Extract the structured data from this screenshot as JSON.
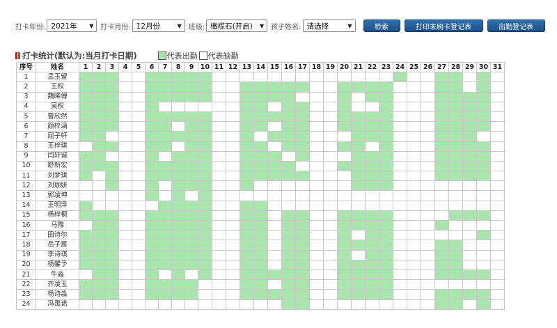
{
  "filters": {
    "year_label": "打卡年份:",
    "year_value": "2021年",
    "month_label": "打卡月份:",
    "month_value": "12月份",
    "class_label": "班级:",
    "class_value": "橄榄石(开启)",
    "child_label": "孩子姓名:",
    "child_value": "请选择"
  },
  "buttons": {
    "search": "检索",
    "print_unpunched": "打印未刷卡登记表",
    "attendance_register": "出勤登记表"
  },
  "stats": {
    "title": "打卡统计(默认为:当月打卡日期)",
    "legend_present": "代表出勤",
    "legend_absent": "代表缺勤"
  },
  "colors": {
    "present": "#a8e6ad",
    "absent": "#ffffff",
    "button": "#1f5a96"
  },
  "table": {
    "col_index": "序号",
    "col_name": "姓名",
    "days": [
      "1",
      "2",
      "3",
      "4",
      "5",
      "6",
      "7",
      "8",
      "9",
      "10",
      "11",
      "12",
      "13",
      "14",
      "15",
      "16",
      "17",
      "18",
      "19",
      "20",
      "21",
      "22",
      "23",
      "24",
      "25",
      "26",
      "27",
      "28",
      "29",
      "30",
      "31"
    ],
    "rows": [
      {
        "index": "1",
        "name": "孟玉留",
        "attendance": [
          1,
          1,
          1,
          0,
          0,
          1,
          1,
          1,
          1,
          1,
          0,
          0,
          0,
          0,
          0,
          0,
          0,
          0,
          0,
          0,
          0,
          0,
          0,
          1,
          0,
          0,
          1,
          1,
          0,
          1,
          0
        ]
      },
      {
        "index": "2",
        "name": "王权",
        "attendance": [
          1,
          1,
          1,
          0,
          0,
          1,
          1,
          1,
          1,
          1,
          0,
          0,
          1,
          1,
          1,
          1,
          1,
          0,
          0,
          1,
          1,
          1,
          1,
          0,
          0,
          0,
          1,
          1,
          0,
          1,
          0
        ]
      },
      {
        "index": "3",
        "name": "魏晞傅",
        "attendance": [
          1,
          1,
          1,
          0,
          0,
          1,
          1,
          1,
          1,
          1,
          0,
          0,
          1,
          1,
          1,
          1,
          0,
          0,
          0,
          1,
          0,
          1,
          1,
          0,
          0,
          0,
          1,
          1,
          1,
          1,
          0
        ]
      },
      {
        "index": "4",
        "name": "吴权",
        "attendance": [
          1,
          1,
          1,
          0,
          0,
          1,
          0,
          0,
          0,
          0,
          0,
          0,
          1,
          1,
          0,
          1,
          1,
          0,
          0,
          1,
          0,
          0,
          1,
          0,
          0,
          0,
          1,
          1,
          1,
          1,
          0
        ]
      },
      {
        "index": "5",
        "name": "曹欣然",
        "attendance": [
          1,
          1,
          1,
          0,
          0,
          1,
          1,
          1,
          1,
          1,
          0,
          0,
          1,
          1,
          1,
          1,
          1,
          0,
          0,
          1,
          1,
          1,
          1,
          0,
          0,
          0,
          1,
          1,
          1,
          1,
          0
        ]
      },
      {
        "index": "6",
        "name": "颜梓涵",
        "attendance": [
          1,
          1,
          1,
          0,
          0,
          1,
          1,
          0,
          1,
          1,
          0,
          0,
          1,
          1,
          0,
          1,
          1,
          0,
          0,
          1,
          1,
          1,
          1,
          0,
          0,
          0,
          1,
          1,
          1,
          1,
          0
        ]
      },
      {
        "index": "7",
        "name": "屈子轩",
        "attendance": [
          1,
          1,
          0,
          0,
          0,
          1,
          1,
          1,
          1,
          1,
          0,
          0,
          1,
          0,
          1,
          1,
          1,
          0,
          0,
          0,
          1,
          1,
          1,
          0,
          0,
          0,
          1,
          1,
          1,
          0,
          0
        ]
      },
      {
        "index": "8",
        "name": "王梓琪",
        "attendance": [
          0,
          1,
          1,
          0,
          0,
          1,
          1,
          0,
          1,
          1,
          0,
          0,
          1,
          1,
          0,
          1,
          1,
          0,
          0,
          1,
          1,
          0,
          1,
          0,
          0,
          0,
          1,
          1,
          1,
          1,
          0
        ]
      },
      {
        "index": "9",
        "name": "闫轩诚",
        "attendance": [
          1,
          1,
          0,
          0,
          0,
          1,
          0,
          1,
          1,
          1,
          0,
          0,
          1,
          1,
          1,
          0,
          1,
          0,
          0,
          0,
          1,
          1,
          1,
          0,
          0,
          0,
          1,
          1,
          1,
          1,
          0
        ]
      },
      {
        "index": "10",
        "name": "舒新宏",
        "attendance": [
          1,
          1,
          1,
          0,
          0,
          1,
          1,
          1,
          1,
          1,
          0,
          0,
          1,
          1,
          1,
          1,
          0,
          0,
          0,
          1,
          1,
          1,
          1,
          0,
          0,
          0,
          1,
          1,
          1,
          1,
          0
        ]
      },
      {
        "index": "11",
        "name": "刘梦琪",
        "attendance": [
          1,
          0,
          1,
          0,
          0,
          1,
          1,
          1,
          1,
          1,
          0,
          0,
          1,
          1,
          1,
          1,
          1,
          0,
          0,
          0,
          1,
          1,
          1,
          0,
          0,
          0,
          1,
          1,
          1,
          1,
          0
        ]
      },
      {
        "index": "12",
        "name": "刘珈妍",
        "attendance": [
          0,
          0,
          1,
          0,
          0,
          1,
          0,
          1,
          1,
          1,
          0,
          0,
          1,
          0,
          0,
          0,
          0,
          0,
          0,
          0,
          1,
          1,
          1,
          0,
          0,
          0,
          0,
          0,
          0,
          0,
          0
        ]
      },
      {
        "index": "13",
        "name": "郭凌坤",
        "attendance": [
          0,
          0,
          0,
          0,
          0,
          1,
          0,
          1,
          0,
          1,
          0,
          0,
          0,
          0,
          0,
          0,
          0,
          0,
          0,
          0,
          0,
          0,
          0,
          0,
          0,
          0,
          0,
          0,
          0,
          0,
          0
        ]
      },
      {
        "index": "14",
        "name": "王明泽",
        "attendance": [
          1,
          0,
          0,
          0,
          0,
          0,
          1,
          1,
          1,
          1,
          0,
          0,
          1,
          1,
          0,
          0,
          0,
          0,
          0,
          0,
          0,
          0,
          0,
          0,
          0,
          0,
          0,
          0,
          0,
          0,
          0
        ]
      },
      {
        "index": "15",
        "name": "杨梓桐",
        "attendance": [
          1,
          1,
          1,
          0,
          0,
          1,
          1,
          1,
          1,
          1,
          0,
          0,
          1,
          1,
          0,
          1,
          1,
          0,
          0,
          1,
          1,
          1,
          1,
          0,
          0,
          0,
          0,
          1,
          1,
          1,
          0
        ]
      },
      {
        "index": "16",
        "name": "马豫",
        "attendance": [
          0,
          1,
          1,
          0,
          0,
          1,
          1,
          1,
          1,
          1,
          0,
          0,
          1,
          1,
          0,
          1,
          1,
          0,
          0,
          1,
          1,
          1,
          1,
          0,
          0,
          0,
          1,
          0,
          0,
          0,
          0
        ]
      },
      {
        "index": "17",
        "name": "田诗尔",
        "attendance": [
          1,
          1,
          1,
          0,
          0,
          1,
          1,
          1,
          1,
          1,
          0,
          0,
          1,
          1,
          0,
          1,
          1,
          0,
          0,
          1,
          0,
          1,
          1,
          0,
          0,
          0,
          0,
          0,
          0,
          1,
          0
        ]
      },
      {
        "index": "18",
        "name": "岳子宸",
        "attendance": [
          1,
          1,
          1,
          0,
          0,
          1,
          1,
          1,
          1,
          1,
          0,
          0,
          1,
          1,
          0,
          1,
          1,
          0,
          0,
          1,
          1,
          1,
          1,
          0,
          0,
          0,
          1,
          1,
          0,
          0,
          0
        ]
      },
      {
        "index": "19",
        "name": "李诗琪",
        "attendance": [
          1,
          1,
          1,
          0,
          0,
          1,
          1,
          1,
          1,
          1,
          0,
          0,
          1,
          1,
          0,
          1,
          1,
          0,
          0,
          1,
          0,
          1,
          1,
          0,
          0,
          0,
          1,
          1,
          0,
          0,
          0
        ]
      },
      {
        "index": "20",
        "name": "杨馨予",
        "attendance": [
          1,
          1,
          1,
          0,
          0,
          1,
          1,
          1,
          1,
          1,
          0,
          0,
          1,
          1,
          0,
          1,
          1,
          0,
          0,
          1,
          1,
          1,
          1,
          0,
          0,
          0,
          1,
          1,
          0,
          0,
          0
        ]
      },
      {
        "index": "21",
        "name": "牛淼",
        "attendance": [
          0,
          1,
          1,
          0,
          0,
          1,
          0,
          1,
          0,
          1,
          0,
          0,
          1,
          1,
          1,
          1,
          1,
          0,
          0,
          1,
          1,
          1,
          1,
          0,
          0,
          0,
          1,
          1,
          1,
          1,
          0
        ]
      },
      {
        "index": "22",
        "name": "齐凌玉",
        "attendance": [
          1,
          1,
          1,
          0,
          0,
          1,
          1,
          1,
          1,
          0,
          0,
          0,
          1,
          1,
          0,
          1,
          1,
          0,
          0,
          1,
          1,
          1,
          1,
          0,
          0,
          0,
          0,
          0,
          0,
          0,
          0
        ]
      },
      {
        "index": "23",
        "name": "杨诗淼",
        "attendance": [
          1,
          1,
          1,
          0,
          0,
          1,
          1,
          1,
          1,
          0,
          0,
          0,
          1,
          1,
          1,
          1,
          1,
          0,
          0,
          1,
          1,
          1,
          1,
          0,
          0,
          0,
          1,
          1,
          1,
          1,
          0
        ]
      },
      {
        "index": "24",
        "name": "冯禹诺",
        "attendance": [
          0,
          0,
          0,
          0,
          0,
          0,
          0,
          0,
          0,
          0,
          0,
          0,
          0,
          0,
          0,
          1,
          1,
          0,
          0,
          0,
          0,
          0,
          0,
          0,
          0,
          0,
          1,
          1,
          0,
          1,
          0
        ]
      }
    ]
  }
}
